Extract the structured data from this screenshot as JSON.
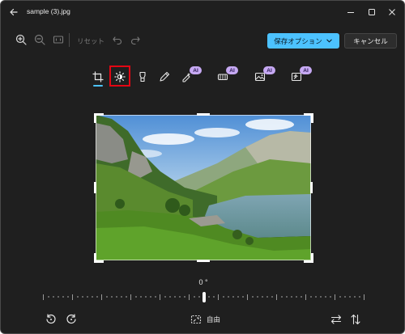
{
  "window": {
    "title": "sample (3).jpg"
  },
  "toolbar": {
    "reset_label": "リセット",
    "save_label": "保存オプション",
    "cancel_label": "キャンセル"
  },
  "tools": {
    "ai_badge": "AI",
    "selected_tool": "adjust",
    "active_tab": "crop"
  },
  "straighten": {
    "angle_label": "0 °",
    "angle_value": 0
  },
  "aspect_ratio": {
    "label": "自由"
  },
  "colors": {
    "accent": "#4cc2ff",
    "highlight_box": "#e30613",
    "ai_badge_bg": "#c6a9f3",
    "window_bg": "#1f1f1f"
  },
  "icons": [
    "back-arrow-icon",
    "minimize-icon",
    "maximize-icon",
    "close-icon",
    "zoom-in-icon",
    "zoom-out-icon",
    "fit-to-window-icon",
    "undo-icon",
    "redo-icon",
    "chevron-down-icon",
    "crop-icon",
    "adjust-brightness-icon",
    "filter-icon",
    "markup-pen-icon",
    "spot-fix-icon",
    "generative-erase-icon",
    "background-icon",
    "generative-fill-icon",
    "rotate-left-icon",
    "rotate-right-icon",
    "aspect-ratio-icon",
    "flip-horizontal-icon",
    "flip-vertical-icon"
  ]
}
